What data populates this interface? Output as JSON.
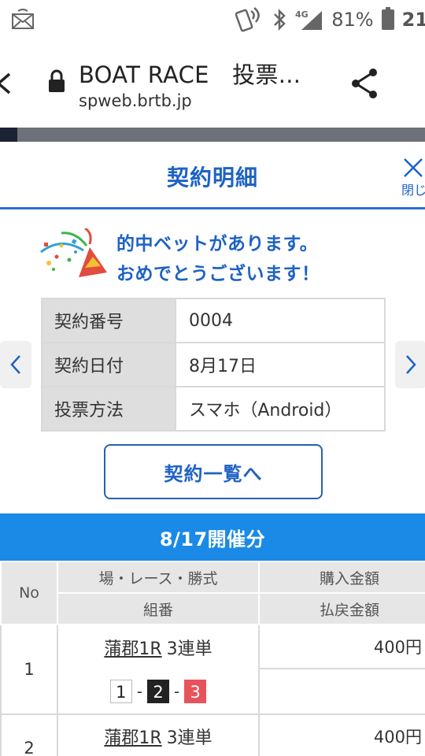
{
  "status_bar": {
    "signal_label": "4G",
    "battery_percent": "81%",
    "time": "21"
  },
  "browser": {
    "page_title": "BOAT RACE　投票...",
    "host": "spweb.brtb.jp"
  },
  "header": {
    "title": "契約明細",
    "close_label": "閉じ"
  },
  "win_message": {
    "line1": "的中ベットがあります。",
    "line2": "おめでとうございます！"
  },
  "contract_info": [
    {
      "label": "契約番号",
      "value": "0004"
    },
    {
      "label": "契約日付",
      "value": "8月17日"
    },
    {
      "label": "投票方法",
      "value": "スマホ（Android）"
    }
  ],
  "list_button_label": "契約一覧へ",
  "section_title": "8/17開催分",
  "bet_table": {
    "headers": {
      "no": "No",
      "race": "場・レース・勝式",
      "combo": "組番",
      "purchase": "購入金額",
      "payout": "払戻金額"
    },
    "rows": [
      {
        "no": "1",
        "race_link": "蒲郡1R",
        "kind": "3連単",
        "combo": [
          "1",
          "2",
          "3"
        ],
        "purchase": "400円",
        "payout": ""
      },
      {
        "no": "2",
        "race_link": "蒲郡1R",
        "kind": "3連単",
        "purchase": "400円"
      }
    ]
  },
  "colors": {
    "accent": "#1e62c4",
    "section_bar": "#1a8ae6",
    "boat1": "#ffffff",
    "boat2": "#222222",
    "boat3": "#e8525a"
  }
}
